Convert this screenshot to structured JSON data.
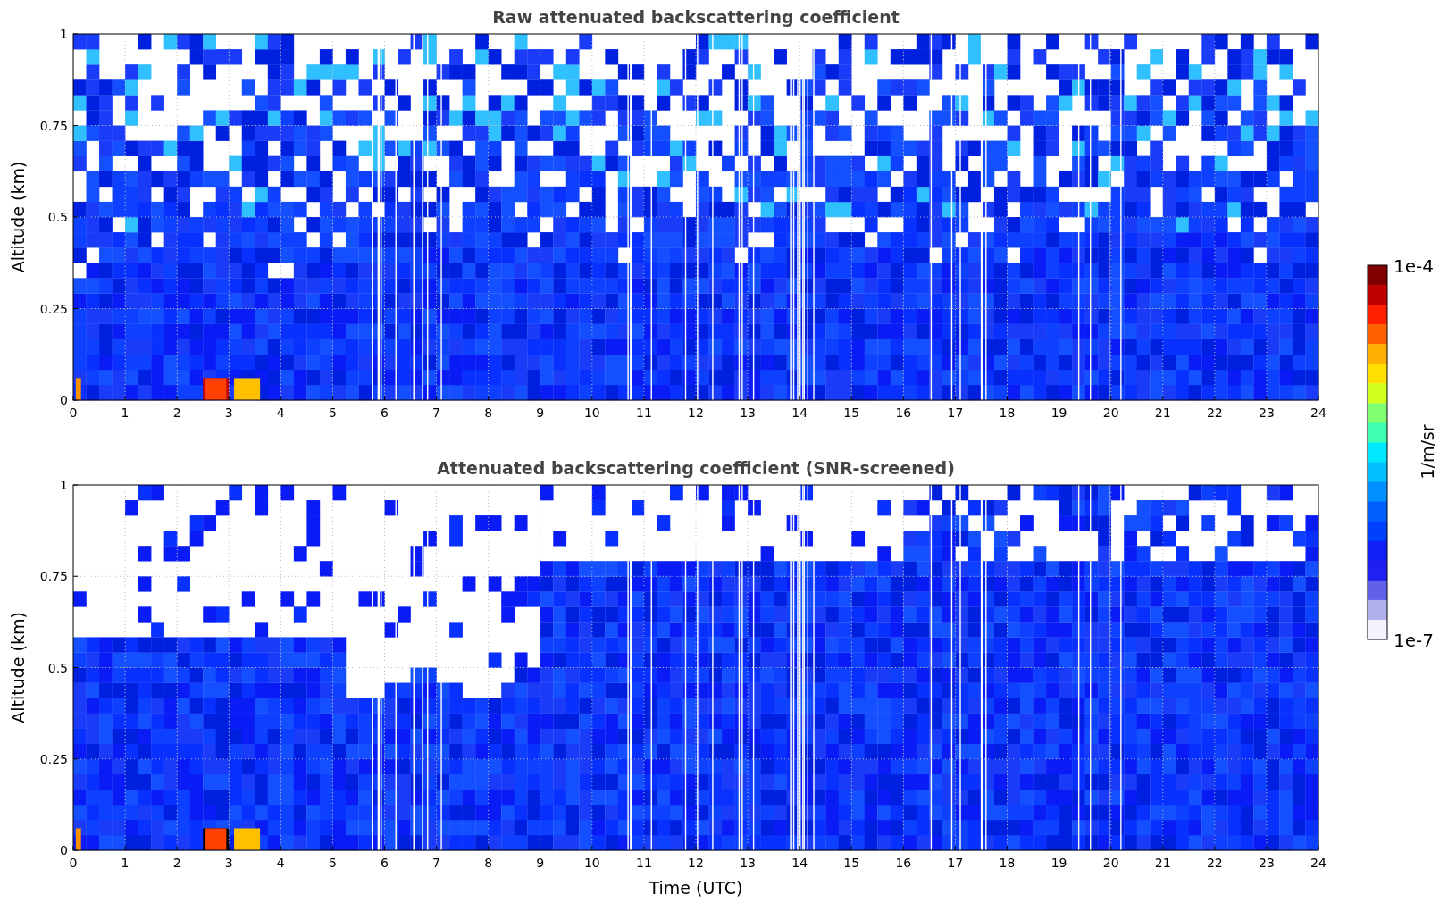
{
  "plots": [
    {
      "kind": "raw",
      "title": "Raw attenuated backscattering coefficient",
      "ylabel": "Altitude (km)",
      "yticks": [
        "1",
        "0.75",
        "0.5",
        "0.25",
        "0"
      ],
      "xticks": [
        "0",
        "1",
        "2",
        "3",
        "4",
        "5",
        "6",
        "7",
        "8",
        "9",
        "10",
        "11",
        "12",
        "13",
        "14",
        "15",
        "16",
        "17",
        "18",
        "19",
        "20",
        "21",
        "22",
        "23",
        "24"
      ]
    },
    {
      "kind": "screened",
      "title": "Attenuated backscattering coefficient (SNR-screened)",
      "ylabel": "Altitude (km)",
      "yticks": [
        "1",
        "0.75",
        "0.5",
        "0.25",
        "0"
      ],
      "xticks": [
        "0",
        "1",
        "2",
        "3",
        "4",
        "5",
        "6",
        "7",
        "8",
        "9",
        "10",
        "11",
        "12",
        "13",
        "14",
        "15",
        "16",
        "17",
        "18",
        "19",
        "20",
        "21",
        "22",
        "23",
        "24"
      ],
      "xlabel": "Time (UTC)"
    }
  ],
  "colorbar": {
    "max": "1e-4",
    "min": "1e-7",
    "label": "1/m/sr"
  }
}
